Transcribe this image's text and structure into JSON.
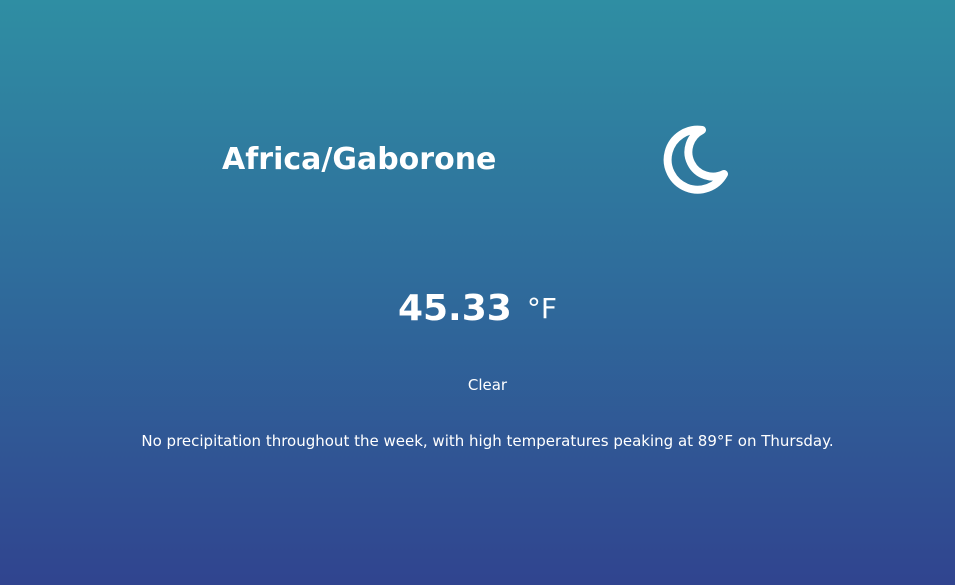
{
  "location": "Africa/Gaborone",
  "weather": {
    "icon": "moon-icon",
    "temperature": "45.33",
    "unit": "°F",
    "condition": "Clear",
    "summary": "No precipitation throughout the week, with high temperatures peaking at 89°F on Thursday."
  },
  "colors": {
    "gradient_top": "#2f8ea3",
    "gradient_middle": "#2f6e9c",
    "gradient_bottom": "#30448f",
    "text": "#ffffff"
  }
}
